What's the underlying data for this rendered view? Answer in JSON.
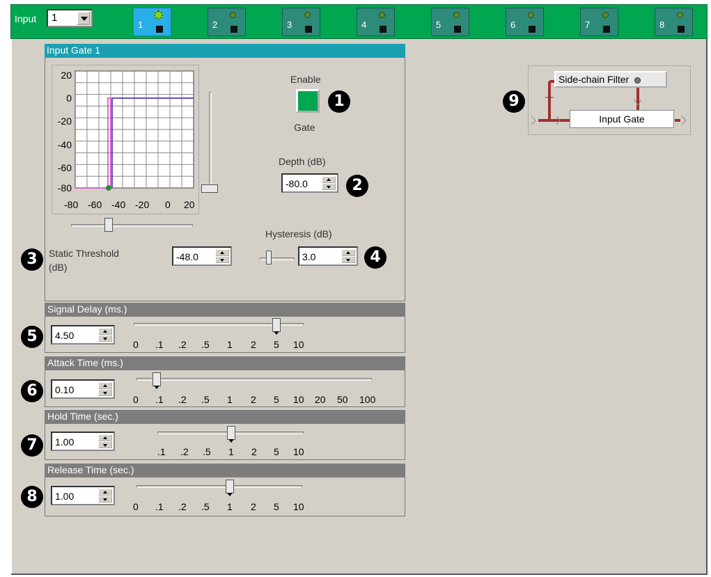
{
  "input_label": "Input",
  "input_select": "1",
  "channels": [
    "1",
    "2",
    "3",
    "4",
    "5",
    "6",
    "7",
    "8"
  ],
  "gate_title": "Input Gate 1",
  "graph": {
    "y_ticks": [
      "20",
      "0",
      "-20",
      "-40",
      "-60",
      "-80"
    ],
    "x_ticks": [
      "-80",
      "-60",
      "-40",
      "-20",
      "0",
      "20"
    ]
  },
  "enable_label": "Enable",
  "gate_label": "Gate",
  "depth_label": "Depth (dB)",
  "depth_value": "-80.0",
  "hysteresis_label": "Hysteresis (dB)",
  "hysteresis_value": "3.0",
  "threshold_label_1": "Static Threshold",
  "threshold_label_2": "(dB)",
  "threshold_value": "-48.0",
  "signal_delay": {
    "title": "Signal Delay (ms.)",
    "value": "4.50",
    "scale": [
      "0",
      ".1",
      ".2",
      ".5",
      "1",
      "2",
      "5",
      "10"
    ]
  },
  "attack_time": {
    "title": "Attack Time (ms.)",
    "value": "0.10",
    "scale": [
      "0",
      ".1",
      ".2",
      ".5",
      "1",
      "2",
      "5",
      "10",
      "20",
      "50",
      "100"
    ]
  },
  "hold_time": {
    "title": "Hold Time (sec.)",
    "value": "1.00",
    "scale": [
      ".1",
      ".2",
      ".5",
      "1",
      "2",
      "5",
      "10"
    ]
  },
  "release_time": {
    "title": "Release Time (sec.)",
    "value": "1.00",
    "scale": [
      "0",
      ".1",
      ".2",
      ".5",
      "1",
      "2",
      "5",
      "10"
    ]
  },
  "badges": [
    "1",
    "2",
    "3",
    "4",
    "5",
    "6",
    "7",
    "8",
    "9"
  ],
  "routing": {
    "sidechain_filter": "Side-chain Filter",
    "input_gate": "Input Gate"
  },
  "colors": {
    "top_bar": "#00a650",
    "selected_channel": "#29aee8",
    "channel": "#2e8b7a",
    "panel_header": "#1aa0b0",
    "section_header": "#7d7d7d",
    "enable_button": "#00a650",
    "routing_line": "#a03030"
  }
}
